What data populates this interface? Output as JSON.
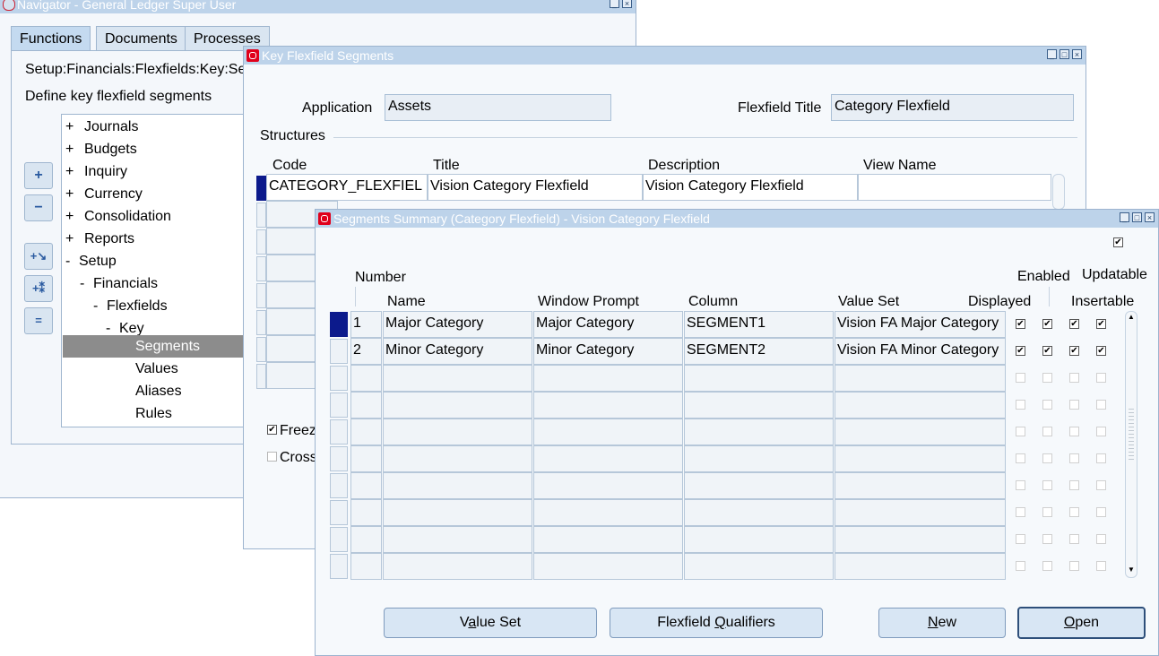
{
  "navigator": {
    "title": "Navigator - General Ledger Super User",
    "tabs": [
      "Functions",
      "Documents",
      "Processes"
    ],
    "breadcrumb": "Setup:Financials:Flexfields:Key:Segments",
    "description": "Define key flexfield segments",
    "tree": [
      {
        "prefix": "+",
        "label": "Journals"
      },
      {
        "prefix": "+",
        "label": "Budgets"
      },
      {
        "prefix": "+",
        "label": "Inquiry"
      },
      {
        "prefix": "+",
        "label": "Currency"
      },
      {
        "prefix": "+",
        "label": "Consolidation"
      },
      {
        "prefix": "+",
        "label": "Reports"
      },
      {
        "prefix": "-",
        "label": "Setup"
      },
      {
        "prefix": "-",
        "label": "Financials"
      },
      {
        "prefix": "-",
        "label": "Flexfields"
      },
      {
        "prefix": "-",
        "label": "Key"
      },
      {
        "prefix": "",
        "label": "Segments"
      },
      {
        "prefix": "",
        "label": "Values"
      },
      {
        "prefix": "",
        "label": "Aliases"
      },
      {
        "prefix": "",
        "label": "Rules"
      }
    ],
    "side_buttons": [
      "+",
      "−",
      "+↘",
      "+*",
      "=−"
    ]
  },
  "kff": {
    "title": "Key Flexfield Segments",
    "application_label": "Application",
    "application_value": "Assets",
    "flexfield_title_label": "Flexfield Title",
    "flexfield_title_value": "Category Flexfield",
    "structures_label": "Structures",
    "columns": [
      "Code",
      "Title",
      "Description",
      "View Name"
    ],
    "row": {
      "code": "CATEGORY_FLEXFIEL",
      "title": "Vision Category Flexfield",
      "description": "Vision Category Flexfield",
      "view_name": ""
    },
    "freeze_label": "Freeze",
    "cross_label": "Cross"
  },
  "summary": {
    "title": "Segments Summary (Category Flexfield) - Vision Category Flexfield",
    "headers": {
      "number": "Number",
      "name": "Name",
      "window_prompt": "Window Prompt",
      "column": "Column",
      "value_set": "Value Set",
      "displayed": "Displayed",
      "enabled": "Enabled",
      "updatable": "Updatable",
      "insertable": "Insertable"
    },
    "rows": [
      {
        "number": "1",
        "name": "Major Category",
        "prompt": "Major Category",
        "column": "SEGMENT1",
        "value_set": "Vision FA Major Category",
        "checks": [
          true,
          true,
          true,
          true
        ]
      },
      {
        "number": "2",
        "name": "Minor Category",
        "prompt": "Minor Category",
        "column": "SEGMENT2",
        "value_set": "Vision FA Minor Category",
        "checks": [
          true,
          true,
          true,
          true
        ]
      }
    ],
    "buttons": {
      "value_set": {
        "pre": "V",
        "u": "a",
        "post": "lue Set"
      },
      "qualifiers": {
        "pre": "Flexfield ",
        "u": "Q",
        "post": "ualifiers"
      },
      "new": {
        "pre": "",
        "u": "N",
        "post": "ew"
      },
      "open": {
        "pre": "",
        "u": "O",
        "post": "pen"
      }
    }
  }
}
